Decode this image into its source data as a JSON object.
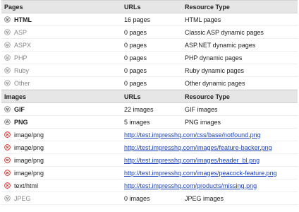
{
  "sections": [
    {
      "header": {
        "col1": "Pages",
        "col2": "URLs",
        "col3": "Resource Type"
      },
      "rows": [
        {
          "name": "HTML",
          "count": "16 pages",
          "type": "HTML pages",
          "icon": "chevron-expand-icon",
          "style": "strong"
        },
        {
          "name": "ASP",
          "count": "0 pages",
          "type": "Classic ASP dynamic pages",
          "icon": "chevron-expand-icon",
          "style": "muted"
        },
        {
          "name": "ASPX",
          "count": "0 pages",
          "type": "ASP.NET dynamic pages",
          "icon": "chevron-expand-icon",
          "style": "muted"
        },
        {
          "name": "PHP",
          "count": "0 pages",
          "type": "PHP dynamic pages",
          "icon": "chevron-expand-icon",
          "style": "muted"
        },
        {
          "name": "Ruby",
          "count": "0 pages",
          "type": "Ruby dynamic pages",
          "icon": "chevron-expand-icon",
          "style": "muted"
        },
        {
          "name": "Other",
          "count": "0 pages",
          "type": "Other dynamic pages",
          "icon": "chevron-expand-icon",
          "style": "muted"
        }
      ]
    },
    {
      "header": {
        "col1": "Images",
        "col2": "URLs",
        "col3": "Resource Type"
      },
      "rows": [
        {
          "name": "GIF",
          "count": "22 images",
          "type": "GIF images",
          "icon": "chevron-expand-icon",
          "style": "strong"
        },
        {
          "name": "PNG",
          "count": "5 images",
          "type": "PNG images",
          "icon": "chevron-expand-icon",
          "style": "strong"
        },
        {
          "name": "image/png",
          "url": "http://test.impresshq.com/css/base/notfound.png",
          "icon": "error-icon"
        },
        {
          "name": "image/png",
          "url": "http://test.impresshq.com/images/feature-backer.png",
          "icon": "error-icon"
        },
        {
          "name": "image/png",
          "url": "http://test.impresshq.com/images/header_bl.png",
          "icon": "error-icon"
        },
        {
          "name": "image/png",
          "url": "http://test.impresshq.com/images/peacock-feature.png",
          "icon": "error-icon"
        },
        {
          "name": "text/html",
          "url": "http://test.impresshq.com/products/missing.png",
          "icon": "error-icon"
        },
        {
          "name": "JPEG",
          "count": "0 images",
          "type": "JPEG images",
          "icon": "chevron-expand-icon",
          "style": "muted"
        }
      ]
    }
  ],
  "colors": {
    "error": "#d9231b",
    "link": "#1a3fb7",
    "header_bg": "#e6e6e6"
  }
}
